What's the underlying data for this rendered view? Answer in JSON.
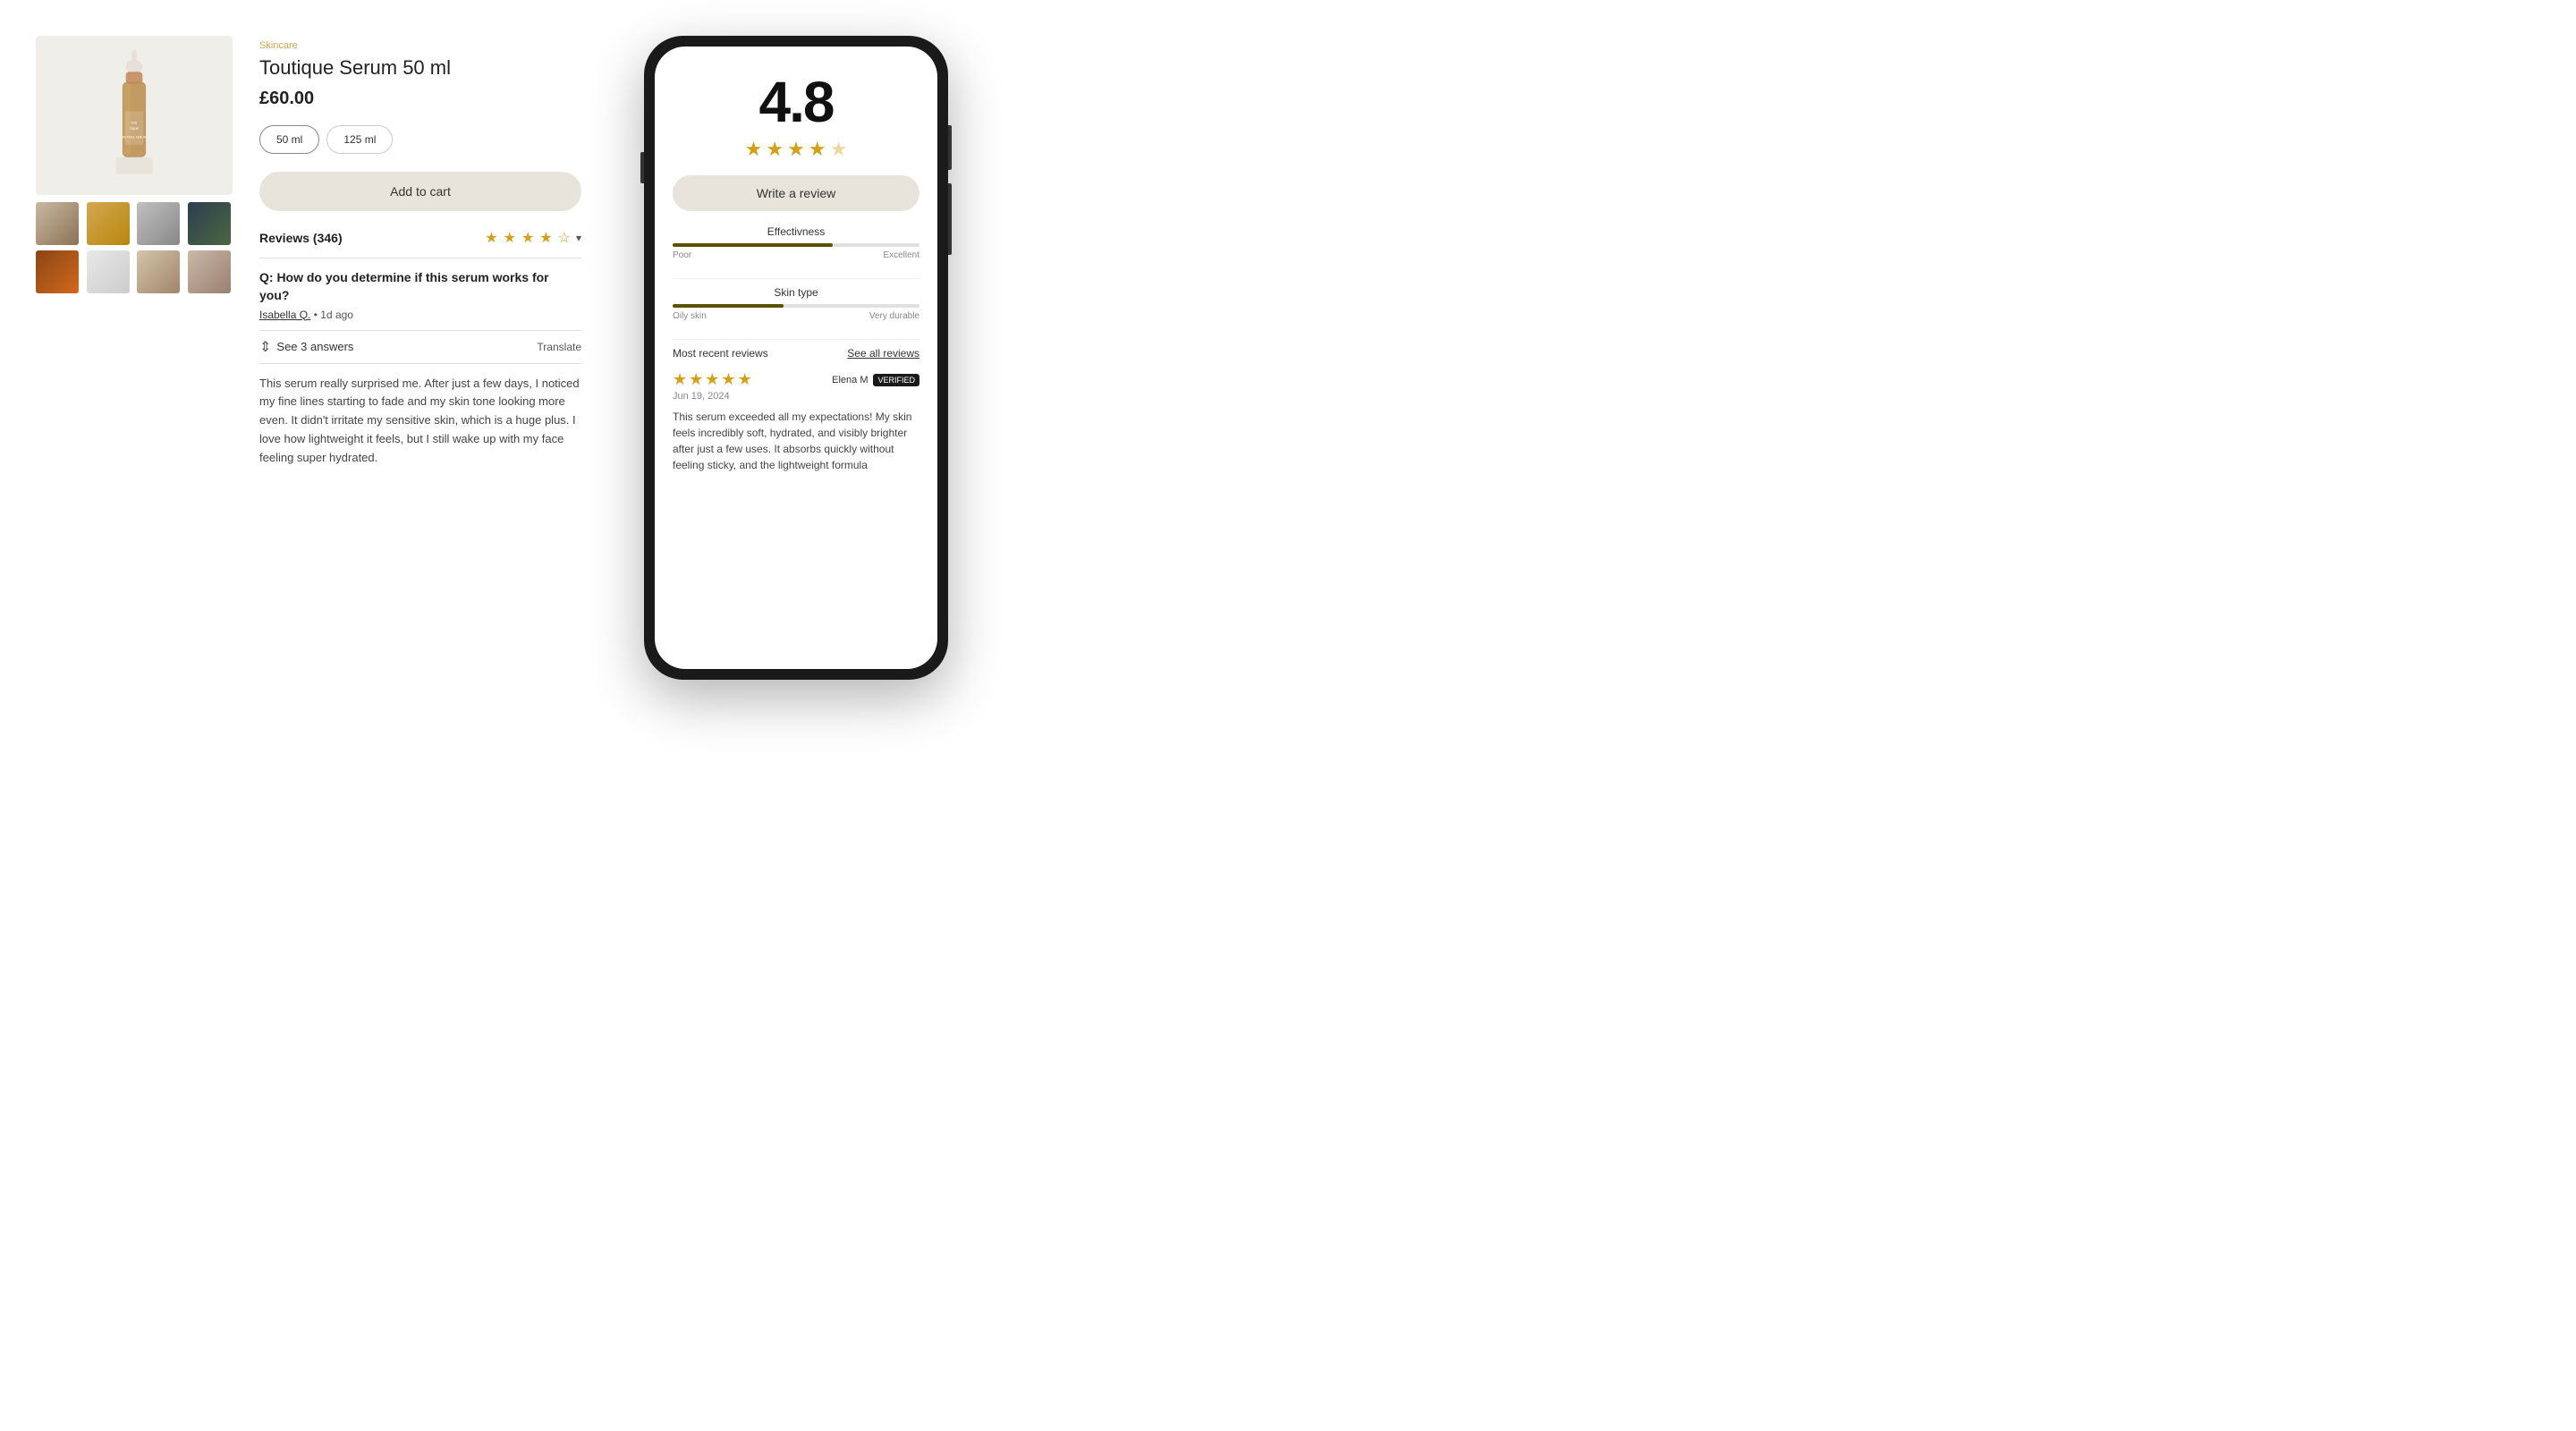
{
  "product": {
    "category": "Skincare",
    "name": "Toutique Serum 50 ml",
    "price": "£60.00",
    "sizes": [
      "50 ml",
      "125 ml"
    ],
    "active_size": "50 ml",
    "add_to_cart_label": "Add to cart"
  },
  "reviews": {
    "title": "Reviews (346)",
    "count": 346,
    "rating": "4.8",
    "see_all_label": "See all reviews",
    "most_recent_label": "Most recent reviews",
    "write_review_label": "Write a review"
  },
  "qa": {
    "question": "Q: How do you determine if this serum works for you?",
    "author": "Isabella Q.",
    "time_ago": "1d ago",
    "see_answers_label": "See 3 answers",
    "translate_label": "Translate"
  },
  "review_text": "This serum really surprised me. After just a few days, I noticed my fine lines starting to fade and my skin tone looking more even. It didn't irritate my sensitive skin, which is a huge plus. I love how lightweight it feels, but I still wake up with my face feeling super hydrated.",
  "mobile": {
    "rating": "4.8",
    "metrics": [
      {
        "label": "Effectivness",
        "fill_percent": 65,
        "left_label": "Poor",
        "right_label": "Excellent"
      },
      {
        "label": "Skin type",
        "fill_percent": 45,
        "left_label": "Oily skin",
        "right_label": "Very durable"
      }
    ],
    "featured_review": {
      "stars": 5,
      "reviewer": "Elena M",
      "verified": "VERIFIED",
      "date": "Jun 19, 2024",
      "text": "This serum exceeded all my expectations! My skin feels incredibly soft, hydrated, and visibly brighter after just a few uses. It absorbs quickly without feeling sticky, and the lightweight formula"
    }
  },
  "thumbnails": [
    {
      "id": 1,
      "class": "thumb-1"
    },
    {
      "id": 2,
      "class": "thumb-2"
    },
    {
      "id": 3,
      "class": "thumb-3"
    },
    {
      "id": 4,
      "class": "thumb-4"
    },
    {
      "id": 5,
      "class": "thumb-5"
    },
    {
      "id": 6,
      "class": "thumb-6"
    },
    {
      "id": 7,
      "class": "thumb-7"
    },
    {
      "id": 8,
      "class": "thumb-8"
    }
  ]
}
